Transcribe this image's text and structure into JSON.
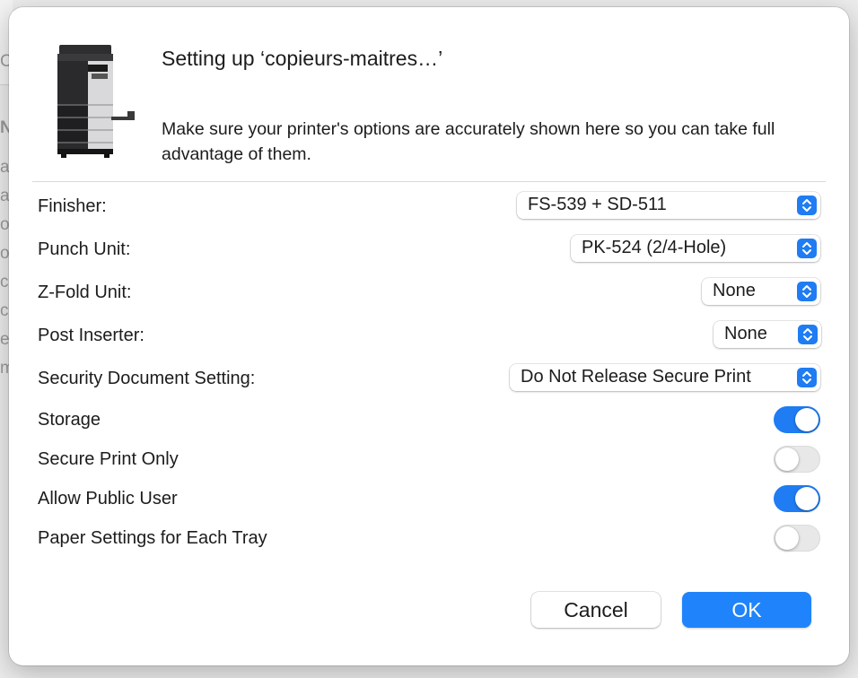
{
  "background_window": {
    "letters": [
      "C",
      "N",
      "a",
      "a",
      "o",
      "o",
      "c",
      "c",
      "e",
      "m"
    ]
  },
  "dialog": {
    "title": "Setting up ‘copieurs-maitres…’",
    "description": "Make sure your printer's options are accurately shown here so you can take full advantage of them.",
    "printer_icon": "printer-copier-icon"
  },
  "options": {
    "finisher": {
      "label": "Finisher:",
      "value": "FS-539 + SD-511"
    },
    "punch_unit": {
      "label": "Punch Unit:",
      "value": "PK-524 (2/4-Hole)"
    },
    "zfold_unit": {
      "label": "Z-Fold Unit:",
      "value": "None"
    },
    "post_inserter": {
      "label": "Post Inserter:",
      "value": "None"
    },
    "security_document": {
      "label": "Security Document Setting:",
      "value": "Do Not Release Secure Print"
    },
    "storage": {
      "label": "Storage",
      "on": true
    },
    "secure_print_only": {
      "label": "Secure Print Only",
      "on": false
    },
    "allow_public_user": {
      "label": "Allow Public User",
      "on": true
    },
    "paper_settings_each_tray": {
      "label": "Paper Settings for Each Tray",
      "on": false
    }
  },
  "buttons": {
    "cancel": "Cancel",
    "ok": "OK"
  },
  "colors": {
    "accent": "#1f7cf2",
    "ok_button": "#1f84fb",
    "toggle_off": "#e8e8e8"
  }
}
